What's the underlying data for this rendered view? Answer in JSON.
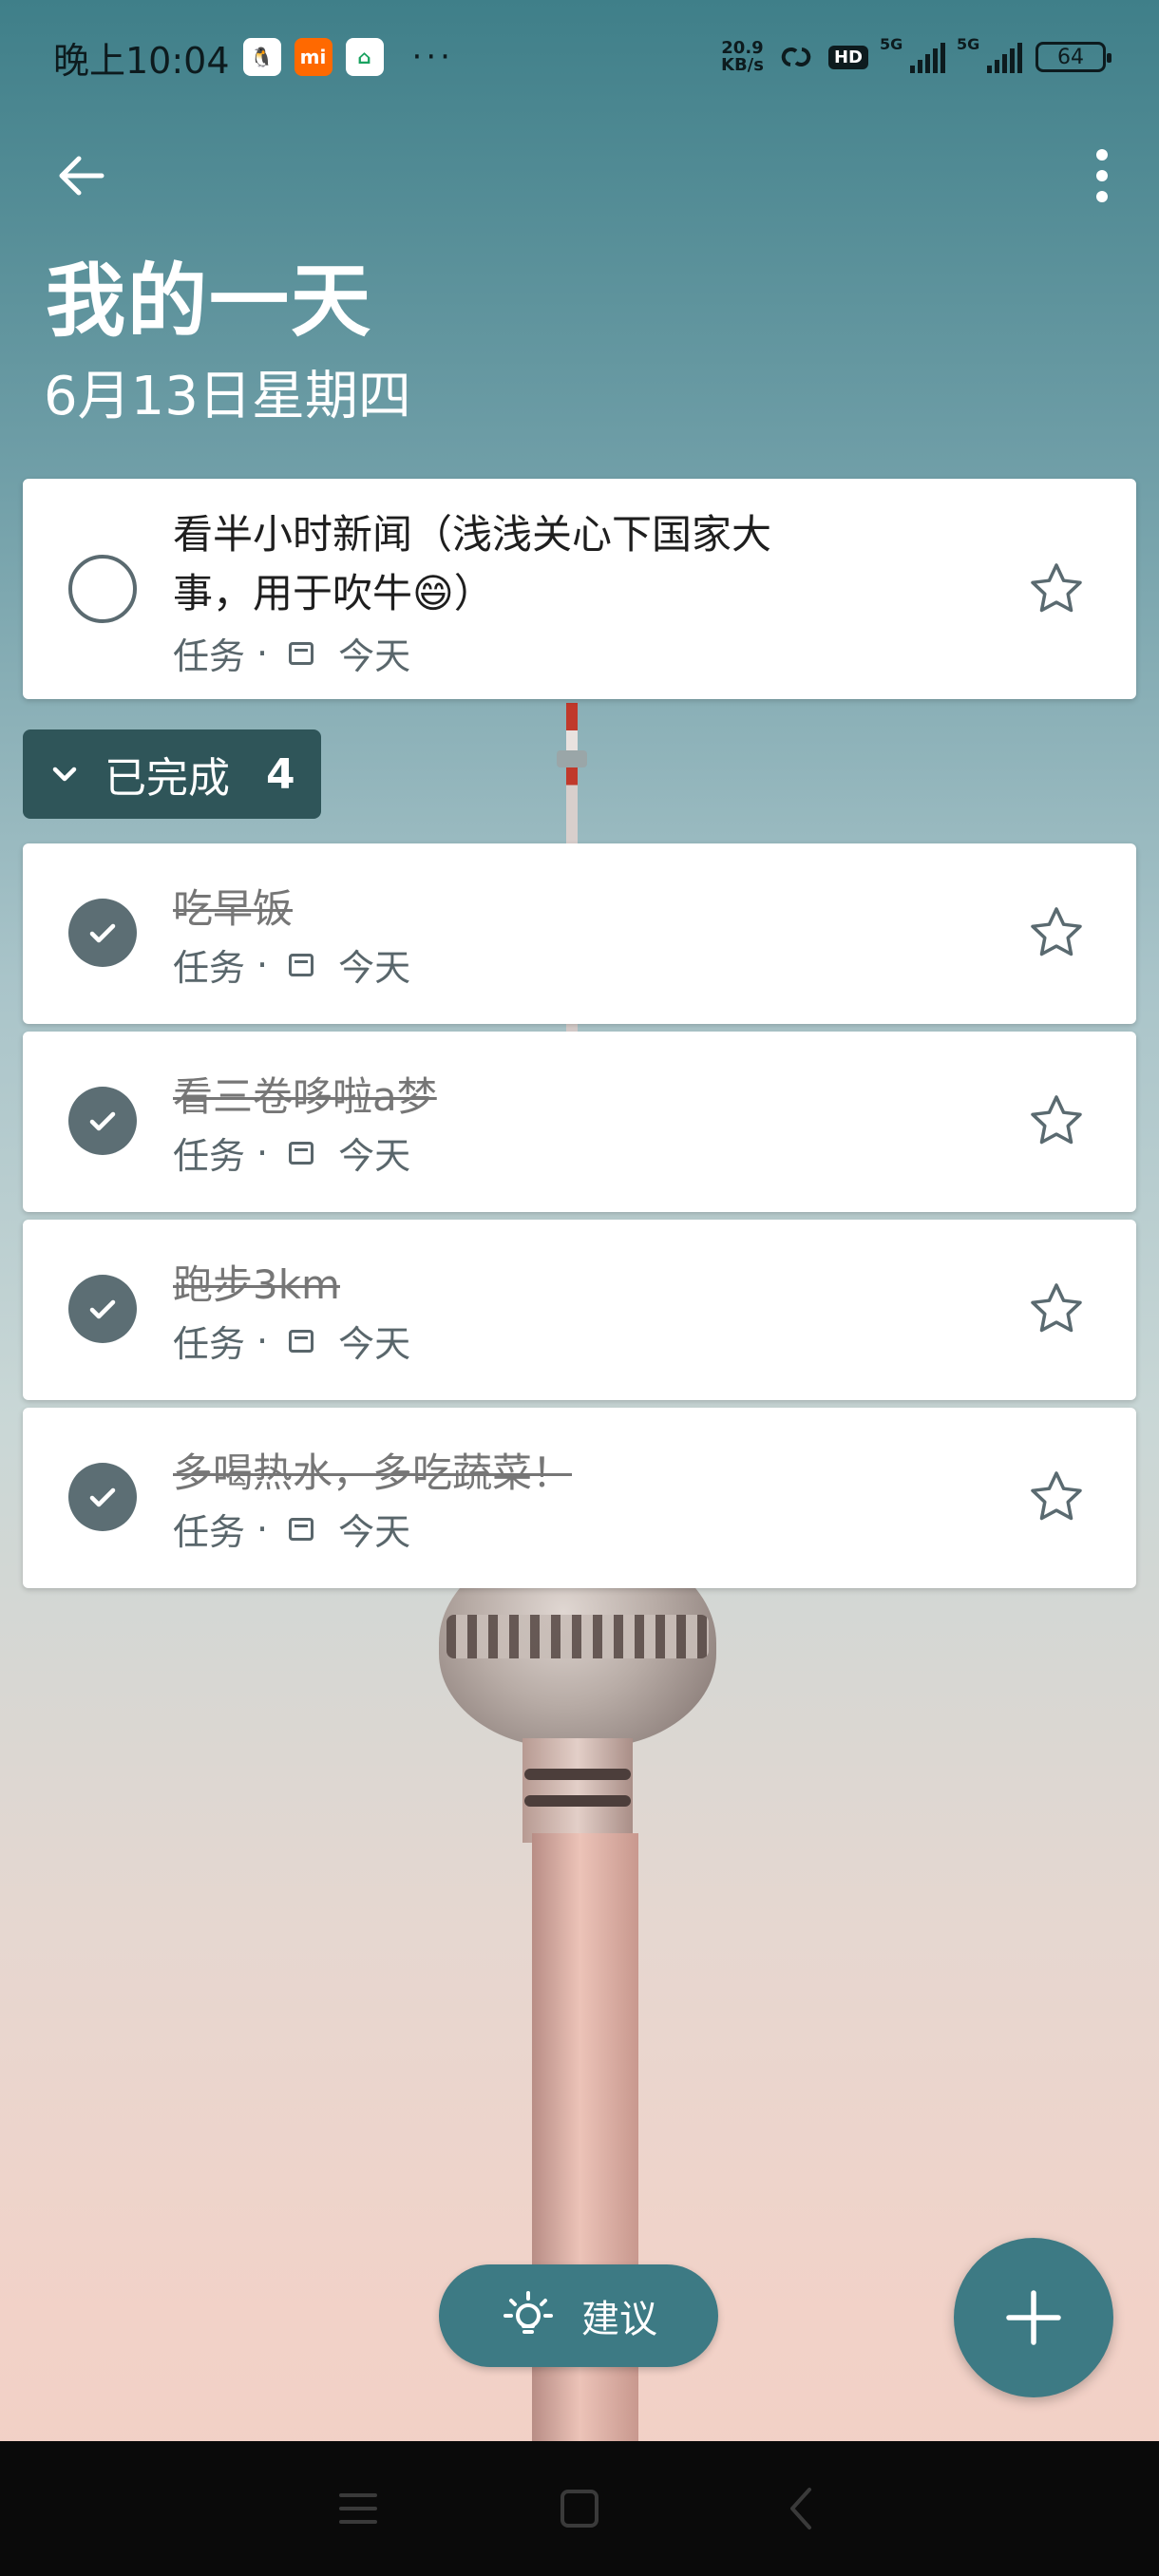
{
  "status_bar": {
    "time": "晚上10:04",
    "speed_value": "20.9",
    "speed_unit": "KB/s",
    "hd": "HD",
    "signal1": "5G",
    "signal2": "5G",
    "battery": "64",
    "more": "···"
  },
  "header": {
    "title": "我的一天",
    "date": "6月13日星期四"
  },
  "pending_tasks": [
    {
      "line1": "看半小时新闻（浅浅关心下国家大",
      "line2": "事，用于吹牛😄）",
      "category": "任务",
      "separator": "·",
      "due": "今天"
    }
  ],
  "completed_section": {
    "label": "已完成",
    "count": "4"
  },
  "completed_tasks": [
    {
      "title": "吃早饭",
      "category": "任务",
      "separator": "·",
      "due": "今天"
    },
    {
      "title": "看三卷哆啦a梦",
      "category": "任务",
      "separator": "·",
      "due": "今天"
    },
    {
      "title": "跑步3km",
      "category": "任务",
      "separator": "·",
      "due": "今天"
    },
    {
      "title": "多喝热水，多吃蔬菜！",
      "category": "任务",
      "separator": "·",
      "due": "今天"
    }
  ],
  "bottom": {
    "suggest_label": "建议"
  },
  "colors": {
    "accent": "#3d7a84",
    "completed_header_bg": "#2f5559",
    "check_done": "#5c6e74"
  }
}
